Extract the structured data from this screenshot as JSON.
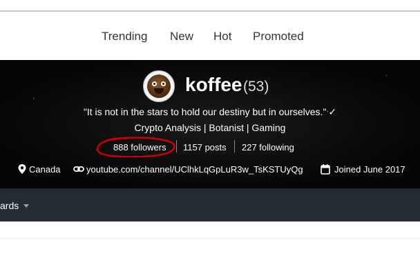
{
  "nav": {
    "items": [
      "Trending",
      "New",
      "Hot",
      "Promoted"
    ]
  },
  "profile": {
    "username": "koffee",
    "reputation": "(53)",
    "about": "\"It is not in the stars to hold our destiny but in ourselves.\"",
    "about_mark": "✓",
    "tags": "Crypto Analysis | Botanist | Gaming",
    "stats": {
      "followers": "888 followers",
      "posts": "1157 posts",
      "following": "227 following"
    },
    "meta": {
      "location": "Canada",
      "website": "youtube.com/channel/UClhkLqGpLuR3w_TsKSTUyQg",
      "joined": "Joined June 2017"
    },
    "annotation_color": "#d00000"
  },
  "subnav": {
    "label": "ards"
  },
  "colors": {
    "subnav_bg": "#232b33",
    "hero_bg": "#050505"
  },
  "icons": [
    "location-pin-icon",
    "link-icon",
    "calendar-icon",
    "chevron-down-icon"
  ]
}
